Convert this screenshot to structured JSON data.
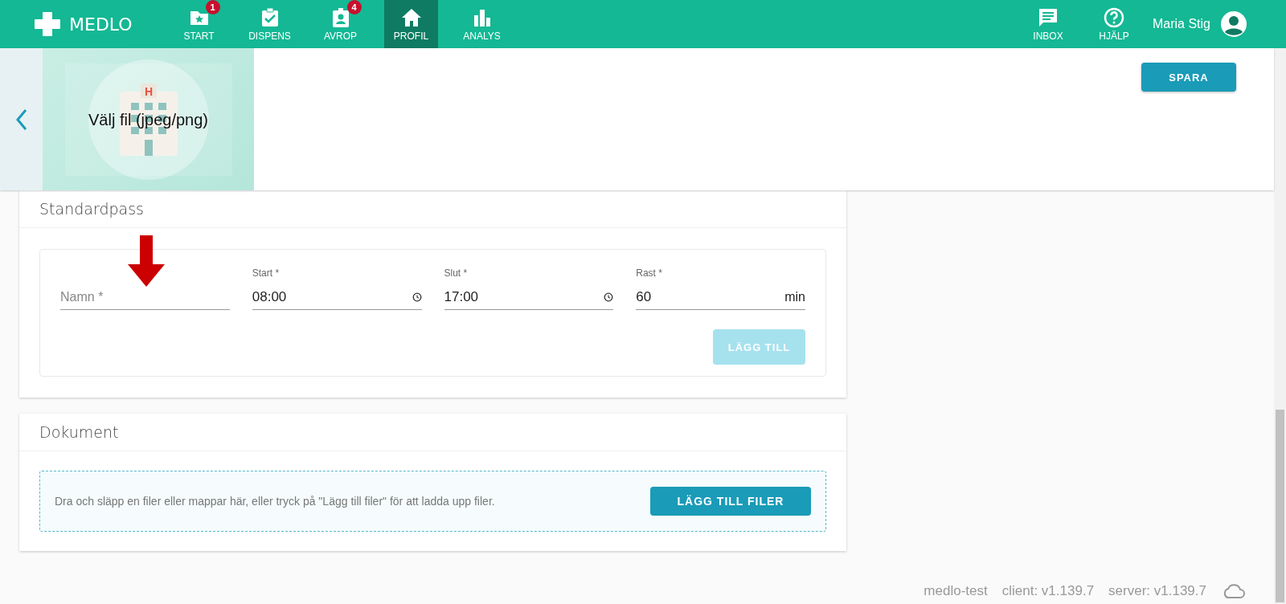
{
  "app": {
    "name": "MEDLO"
  },
  "nav": [
    {
      "label": "START",
      "badge": "1",
      "selected": false
    },
    {
      "label": "DISPENS",
      "selected": false
    },
    {
      "label": "AVROP",
      "badge": "4",
      "selected": false
    },
    {
      "label": "PROFIL",
      "selected": true
    },
    {
      "label": "ANALYS",
      "selected": false
    }
  ],
  "header_actions": [
    {
      "label": "INBOX"
    },
    {
      "label": "HJÄLP"
    }
  ],
  "user": {
    "name": "Maria Stig"
  },
  "image_upload": {
    "sign": "H",
    "label": "Välj fil (jpeg/png)"
  },
  "save_button": "SPARA",
  "standardpass": {
    "title": "Standardpass",
    "fields": [
      {
        "kind": "text",
        "placeholder": "Namn *"
      },
      {
        "kind": "time",
        "label": "Start *",
        "value": "08:00"
      },
      {
        "kind": "time",
        "label": "Slut *",
        "value": "17:00"
      },
      {
        "kind": "number",
        "label": "Rast *",
        "value": "60",
        "suffix": "min"
      }
    ],
    "add_button": {
      "label": "LÄGG TILL",
      "disabled": true
    }
  },
  "dokument": {
    "title": "Dokument",
    "hint": "Dra och släpp en filer eller mappar här, eller tryck på \"Lägg till filer\" för att ladda upp filer.",
    "button": "LÄGG TILL FILER"
  },
  "footer": [
    "medlo-test",
    "client: v1.139.7",
    "server: v1.139.7"
  ]
}
